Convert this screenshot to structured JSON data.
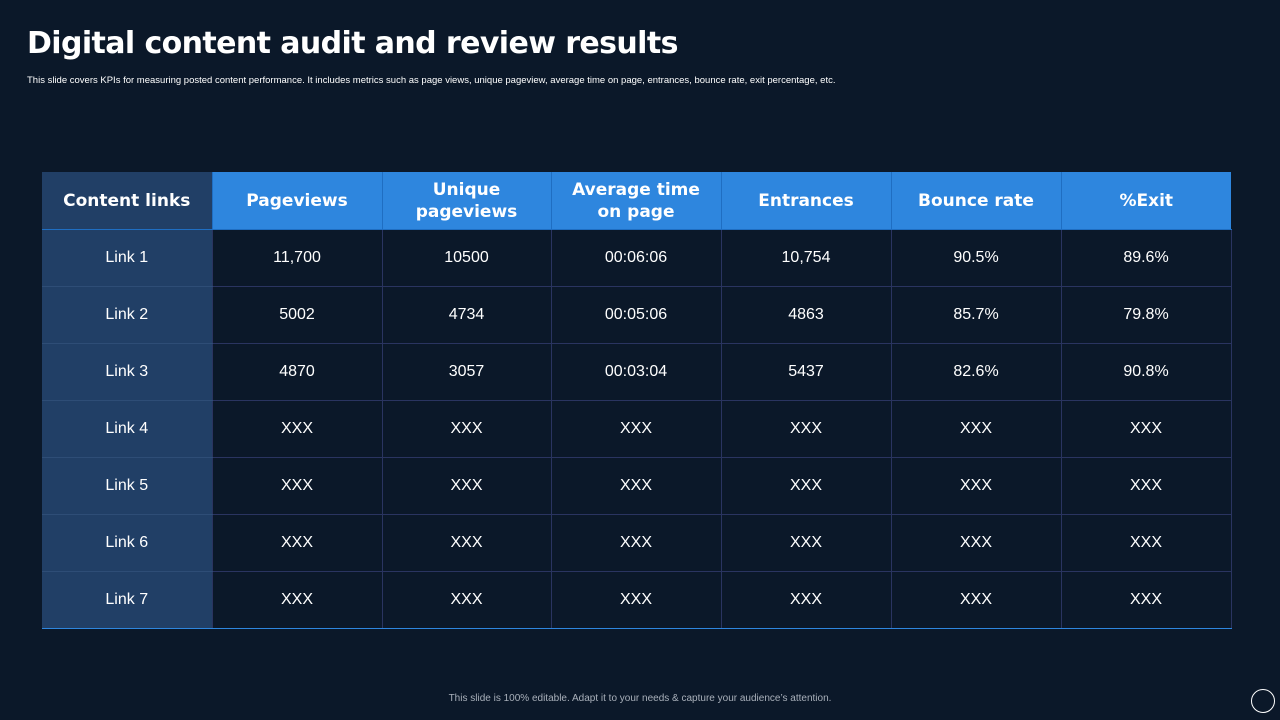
{
  "slide": {
    "title": "Digital content audit and review results",
    "subtitle": "This slide covers KPIs for measuring posted content performance. It includes metrics such as page views, unique pageview, average time on page, entrances, bounce rate, exit percentage, etc.",
    "footer": "This slide is 100% editable.  Adapt it to your needs & capture your audience’s attention."
  },
  "table": {
    "headers": [
      "Content links",
      "Pageviews",
      "Unique pageviews",
      "Average time on page",
      "Entrances",
      "Bounce rate",
      "%Exit"
    ],
    "rows": [
      [
        "Link 1",
        "11,700",
        "10500",
        "00:06:06",
        "10,754",
        "90.5%",
        "89.6%"
      ],
      [
        "Link 2",
        "5002",
        "4734",
        "00:05:06",
        "4863",
        "85.7%",
        "79.8%"
      ],
      [
        "Link 3",
        "4870",
        "3057",
        "00:03:04",
        "5437",
        "82.6%",
        "90.8%"
      ],
      [
        "Link 4",
        "XXX",
        "XXX",
        "XXX",
        "XXX",
        "XXX",
        "XXX"
      ],
      [
        "Link 5",
        "XXX",
        "XXX",
        "XXX",
        "XXX",
        "XXX",
        "XXX"
      ],
      [
        "Link 6",
        "XXX",
        "XXX",
        "XXX",
        "XXX",
        "XXX",
        "XXX"
      ],
      [
        "Link 7",
        "XXX",
        "XXX",
        "XXX",
        "XXX",
        "XXX",
        "XXX"
      ]
    ]
  },
  "colors": {
    "background": "#0b1829",
    "header_accent": "#2e86de",
    "first_column": "#213f66"
  },
  "icons": {
    "nav": "circle-outline-icon"
  }
}
